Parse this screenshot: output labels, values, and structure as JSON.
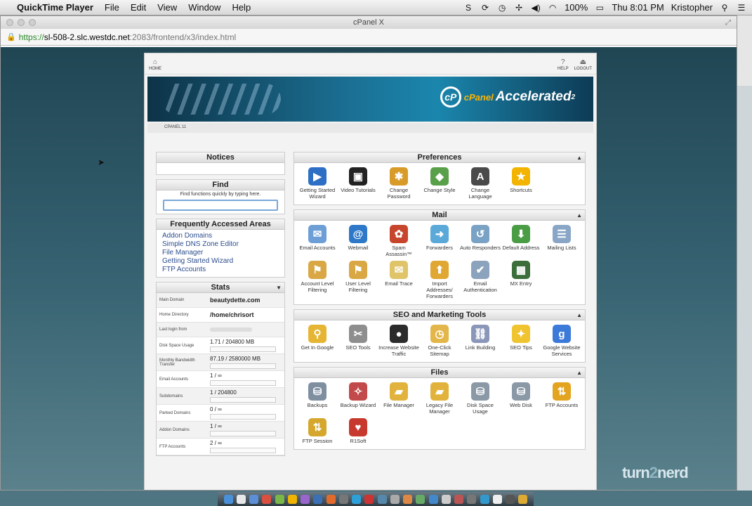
{
  "menubar": {
    "app_name": "QuickTime Player",
    "menus": [
      "File",
      "Edit",
      "View",
      "Window",
      "Help"
    ],
    "battery": "100%",
    "clock": "Thu 8:01 PM",
    "user": "Kristopher"
  },
  "browser": {
    "window_title": "cPanel X",
    "url_scheme": "https://",
    "url_host": "sl-508-2.slc.westdc.net",
    "url_path": ":2083/frontend/x3/index.html"
  },
  "cpanel": {
    "nav": {
      "home": "HOME",
      "help": "HELP",
      "logout": "LOGOUT"
    },
    "banner": {
      "logo_word": "cPanel",
      "logo_tag": "Accelerated",
      "logo_sub": "2"
    },
    "breadcrumb": "CPANEL 11",
    "notices": {
      "title": "Notices"
    },
    "find": {
      "title": "Find",
      "hint": "Find functions quickly by typing here."
    },
    "faa": {
      "title": "Frequently Accessed Areas",
      "links": [
        "Addon Domains",
        "Simple DNS Zone Editor",
        "File Manager",
        "Getting Started Wizard",
        "FTP Accounts"
      ]
    },
    "stats": {
      "title": "Stats",
      "rows": [
        {
          "label": "Main Domain",
          "value": "beautydette.com"
        },
        {
          "label": "Home Directory",
          "value": "/home/chrisort"
        },
        {
          "label": "Last login from",
          "value": ""
        },
        {
          "label": "Disk Space Usage",
          "value": "1.71 / 204800 MB"
        },
        {
          "label": "Monthly Bandwidth Transfer",
          "value": "87.19 / 2580000 MB"
        },
        {
          "label": "Email Accounts",
          "value": "1 / ∞"
        },
        {
          "label": "Subdomains",
          "value": "1 / 204800"
        },
        {
          "label": "Parked Domains",
          "value": "0 / ∞"
        },
        {
          "label": "Addon Domains",
          "value": "1 / ∞"
        },
        {
          "label": "FTP Accounts",
          "value": "2 / ∞"
        }
      ]
    },
    "sections": [
      {
        "title": "Preferences",
        "items": [
          {
            "label": "Getting Started Wizard",
            "icon": "play-icon",
            "color": "#2c6fc4",
            "glyph": "▶"
          },
          {
            "label": "Video Tutorials",
            "icon": "clapperboard-icon",
            "color": "#222222",
            "glyph": "▣"
          },
          {
            "label": "Change Password",
            "icon": "password-icon",
            "color": "#d89b2a",
            "glyph": "✱"
          },
          {
            "label": "Change Style",
            "icon": "style-icon",
            "color": "#5aa04a",
            "glyph": "◆"
          },
          {
            "label": "Change Language",
            "icon": "language-icon",
            "color": "#4a4a4a",
            "glyph": "A"
          },
          {
            "label": "Shortcuts",
            "icon": "star-icon",
            "color": "#f2b400",
            "glyph": "★"
          }
        ]
      },
      {
        "title": "Mail",
        "items": [
          {
            "label": "Email Accounts",
            "icon": "envelope-icon",
            "color": "#6d9fd6",
            "glyph": "✉"
          },
          {
            "label": "Webmail",
            "icon": "webmail-icon",
            "color": "#2d78c8",
            "glyph": "@"
          },
          {
            "label": "Spam Assassin™",
            "icon": "spam-icon",
            "color": "#c7452d",
            "glyph": "✿"
          },
          {
            "label": "Forwarders",
            "icon": "forward-icon",
            "color": "#5aa9d8",
            "glyph": "➜"
          },
          {
            "label": "Auto Responders",
            "icon": "responder-icon",
            "color": "#7aa2c4",
            "glyph": "↺"
          },
          {
            "label": "Default Address",
            "icon": "default-address-icon",
            "color": "#4a9d45",
            "glyph": "⬇"
          },
          {
            "label": "Mailing Lists",
            "icon": "mailing-list-icon",
            "color": "#8aa6c6",
            "glyph": "☰"
          },
          {
            "label": "Account Level Filtering",
            "icon": "filter-icon",
            "color": "#d9a845",
            "glyph": "⚑"
          },
          {
            "label": "User Level Filtering",
            "icon": "user-filter-icon",
            "color": "#d9a845",
            "glyph": "⚑"
          },
          {
            "label": "Email Trace",
            "icon": "trace-icon",
            "color": "#e0c46a",
            "glyph": "✉"
          },
          {
            "label": "Import Addresses/ Forwarders",
            "icon": "import-icon",
            "color": "#e0a732",
            "glyph": "⬆"
          },
          {
            "label": "Email Authentication",
            "icon": "auth-icon",
            "color": "#8ca3bd",
            "glyph": "✔"
          },
          {
            "label": "MX Entry",
            "icon": "mx-icon",
            "color": "#3b6e3b",
            "glyph": "▦"
          }
        ]
      },
      {
        "title": "SEO and Marketing Tools",
        "items": [
          {
            "label": "Get In Google",
            "icon": "magnifier-icon",
            "color": "#e5b533",
            "glyph": "⚲"
          },
          {
            "label": "SEO Tools",
            "icon": "tools-icon",
            "color": "#8e8e8e",
            "glyph": "✂"
          },
          {
            "label": "Increase Website Traffic",
            "icon": "traffic-light-icon",
            "color": "#2b2b2b",
            "glyph": "●"
          },
          {
            "label": "One-Click Sitemap",
            "icon": "sitemap-icon",
            "color": "#e3b64a",
            "glyph": "◷"
          },
          {
            "label": "Link Building",
            "icon": "link-icon",
            "color": "#8b97b8",
            "glyph": "⛓"
          },
          {
            "label": "SEO Tips",
            "icon": "lightbulb-icon",
            "color": "#f0c430",
            "glyph": "✦"
          },
          {
            "label": "Google Website Services",
            "icon": "google-icon",
            "color": "#3c7ad9",
            "glyph": "g"
          }
        ]
      },
      {
        "title": "Files",
        "items": [
          {
            "label": "Backups",
            "icon": "backup-icon",
            "color": "#7f8fa0",
            "glyph": "⛁"
          },
          {
            "label": "Backup Wizard",
            "icon": "backup-wizard-icon",
            "color": "#c24a4a",
            "glyph": "✧"
          },
          {
            "label": "File Manager",
            "icon": "folder-icon",
            "color": "#e2b33c",
            "glyph": "▰"
          },
          {
            "label": "Legacy File Manager",
            "icon": "legacy-folder-icon",
            "color": "#e2b33c",
            "glyph": "▰"
          },
          {
            "label": "Disk Space Usage",
            "icon": "disk-usage-icon",
            "color": "#8b98a6",
            "glyph": "⛁"
          },
          {
            "label": "Web Disk",
            "icon": "web-disk-icon",
            "color": "#8b98a6",
            "glyph": "⛁"
          },
          {
            "label": "FTP Accounts",
            "icon": "ftp-icon",
            "color": "#e3a421",
            "glyph": "⇅"
          },
          {
            "label": "FTP Session",
            "icon": "ftp-session-icon",
            "color": "#d6a72d",
            "glyph": "⇅"
          },
          {
            "label": "R1Soft",
            "icon": "r1soft-icon",
            "color": "#c7392f",
            "glyph": "♥"
          }
        ]
      }
    ]
  },
  "watermark": {
    "part1": "turn",
    "part2": "2",
    "part3": "nerd"
  }
}
